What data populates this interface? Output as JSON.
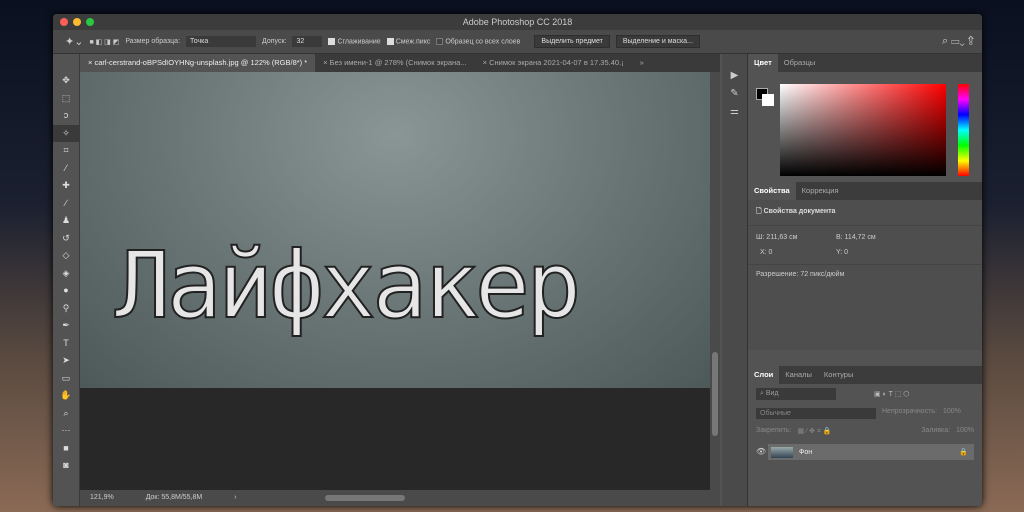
{
  "app": {
    "title": "Adobe Photoshop CC 2018"
  },
  "options": {
    "sample_size_label": "Размер образца:",
    "sample_size_value": "Точка",
    "tolerance_label": "Допуск:",
    "tolerance_value": "32",
    "antialias": "Сглаживание",
    "contiguous": "Смеж.пикс",
    "all_layers": "Образец со всех слоев",
    "select_subject": "Выделить предмет",
    "select_mask": "Выделение и маска..."
  },
  "tabs": [
    {
      "label": "carl-cerstrand-oBPSdIOYHNg-unsplash.jpg @ 122% (RGB/8*) *",
      "active": true
    },
    {
      "label": "Без имени-1 @ 278% (Снимок экрана...",
      "active": false
    },
    {
      "label": "Снимок экрана 2021-04-07 в 17.35.40.¡",
      "active": false
    }
  ],
  "canvas": {
    "text": "Лайфхакер"
  },
  "status": {
    "zoom": "121,9%",
    "doc": "Док: 55,8M/55,8M"
  },
  "color_panel": {
    "tabs": [
      "Цвет",
      "Образцы"
    ],
    "hue_color": "#ff0000"
  },
  "properties": {
    "tabs": [
      "Свойства",
      "Коррекция"
    ],
    "title": "Свойства документа",
    "width": "Ш: 211,63 см",
    "height": "В: 114,72 см",
    "x": "X: 0",
    "y": "Y: 0",
    "resolution": "Разрешение: 72 пикс/дюйм"
  },
  "layers": {
    "tabs": [
      "Слои",
      "Каналы",
      "Контуры"
    ],
    "filter": "Вид",
    "blend": "Обычные",
    "opacity_label": "Непрозрачность:",
    "opacity": "100%",
    "lock_label": "Закрепить:",
    "fill_label": "Заливка:",
    "fill": "100%",
    "items": [
      {
        "name": "Фон",
        "visible": true,
        "locked": true
      }
    ]
  }
}
